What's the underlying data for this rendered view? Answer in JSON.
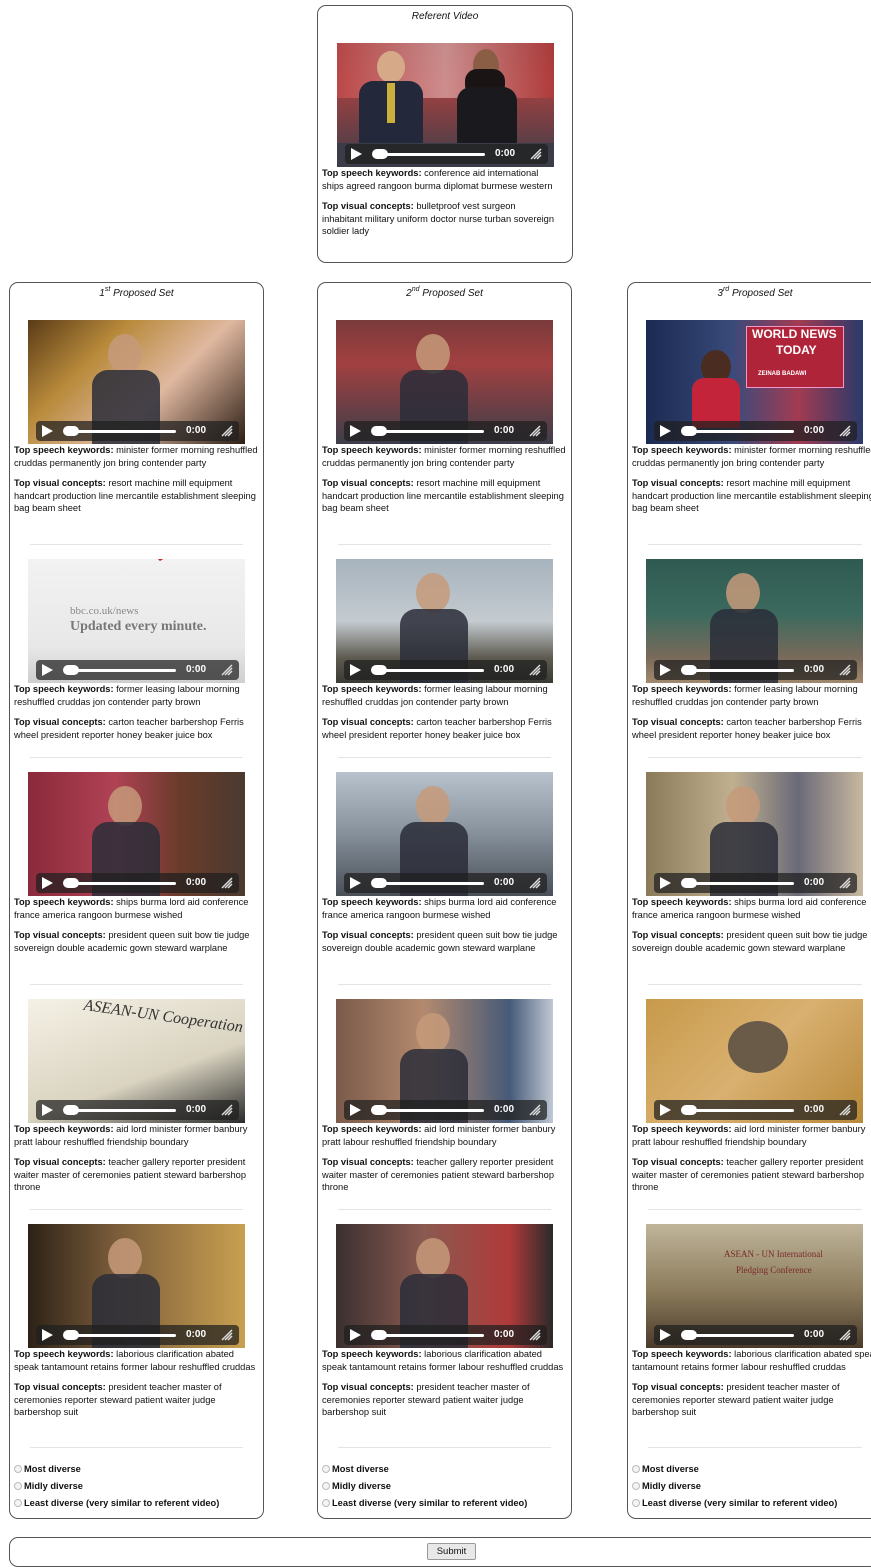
{
  "referent": {
    "title": "Referent Video",
    "time": "0:00",
    "speech_label": "Top speech keywords:",
    "speech": "conference aid international ships agreed rangoon burma diplomat burmese western",
    "visual_label": "Top visual concepts:",
    "visual": "bulletproof vest surgeon inhabitant military uniform doctor nurse turban sovereign soldier lady"
  },
  "sets": [
    {
      "num": "1",
      "sup": "st",
      "title_suffix": " Proposed Set",
      "videos": [
        {
          "time": "0:00",
          "speech_label": "Top speech keywords:",
          "speech": "minister former morning reshuffled cruddas permanently jon bring contender party",
          "visual_label": "Top visual concepts:",
          "visual": "resort machine mill equipment handcart production line mercantile establishment sleeping bag beam sheet"
        },
        {
          "time": "0:00",
          "speech_label": "Top speech keywords:",
          "speech": "former leasing labour morning reshuffled cruddas jon contender party brown",
          "visual_label": "Top visual concepts:",
          "visual": "carton teacher barbershop Ferris wheel president reporter honey beaker juice box",
          "overlay_text_1": "bbc.co.uk/news",
          "overlay_text_2": "Updated every minute."
        },
        {
          "time": "0:00",
          "speech_label": "Top speech keywords:",
          "speech": "ships burma lord aid conference france america rangoon burmese wished",
          "visual_label": "Top visual concepts:",
          "visual": "president queen suit bow tie judge sovereign double academic gown steward warplane"
        },
        {
          "time": "0:00",
          "speech_label": "Top speech keywords:",
          "speech": "aid lord minister former banbury pratt labour reshuffled friendship boundary",
          "visual_label": "Top visual concepts:",
          "visual": "teacher gallery reporter president waiter master of ceremonies patient steward barbershop throne",
          "overlay_text_1": "ASEAN-UN Cooperation"
        },
        {
          "time": "0:00",
          "speech_label": "Top speech keywords:",
          "speech": "laborious clarification abated speak tantamount retains former labour reshuffled cruddas",
          "visual_label": "Top visual concepts:",
          "visual": "president teacher master of ceremonies reporter steward patient waiter judge barbershop suit"
        }
      ],
      "ratings": [
        "Most diverse",
        "Midly diverse",
        "Least diverse (very similar to referent video)"
      ]
    },
    {
      "num": "2",
      "sup": "nd",
      "title_suffix": " Proposed Set",
      "videos": [
        {
          "time": "0:00",
          "speech_label": "Top speech keywords:",
          "speech": "minister former morning reshuffled cruddas permanently jon bring contender party",
          "visual_label": "Top visual concepts:",
          "visual": "resort machine mill equipment handcart production line mercantile establishment sleeping bag beam sheet"
        },
        {
          "time": "0:00",
          "speech_label": "Top speech keywords:",
          "speech": "former leasing labour morning reshuffled cruddas jon contender party brown",
          "visual_label": "Top visual concepts:",
          "visual": "carton teacher barbershop Ferris wheel president reporter honey beaker juice box"
        },
        {
          "time": "0:00",
          "speech_label": "Top speech keywords:",
          "speech": "ships burma lord aid conference france america rangoon burmese wished",
          "visual_label": "Top visual concepts:",
          "visual": "president queen suit bow tie judge sovereign double academic gown steward warplane"
        },
        {
          "time": "0:00",
          "speech_label": "Top speech keywords:",
          "speech": "aid lord minister former banbury pratt labour reshuffled friendship boundary",
          "visual_label": "Top visual concepts:",
          "visual": "teacher gallery reporter president waiter master of ceremonies patient steward barbershop throne"
        },
        {
          "time": "0:00",
          "speech_label": "Top speech keywords:",
          "speech": "laborious clarification abated speak tantamount retains former labour reshuffled cruddas",
          "visual_label": "Top visual concepts:",
          "visual": "president teacher master of ceremonies reporter steward patient waiter judge barbershop suit"
        }
      ],
      "ratings": [
        "Most diverse",
        "Midly diverse",
        "Least diverse (very similar to referent video)"
      ]
    },
    {
      "num": "3",
      "sup": "rd",
      "title_suffix": " Proposed Set",
      "videos": [
        {
          "time": "0:00",
          "speech_label": "Top speech keywords:",
          "speech": "minister former morning reshuffled cruddas permanently jon bring contender party",
          "visual_label": "Top visual concepts:",
          "visual": "resort machine mill equipment handcart production line mercantile establishment sleeping bag beam sheet",
          "overlay_text_1": "WORLD NEWS",
          "overlay_text_2": "TODAY",
          "overlay_text_3": "ZEINAB BADAWI"
        },
        {
          "time": "0:00",
          "speech_label": "Top speech keywords:",
          "speech": "former leasing labour morning reshuffled cruddas jon contender party brown",
          "visual_label": "Top visual concepts:",
          "visual": "carton teacher barbershop Ferris wheel president reporter honey beaker juice box"
        },
        {
          "time": "0:00",
          "speech_label": "Top speech keywords:",
          "speech": "ships burma lord aid conference france america rangoon burmese wished",
          "visual_label": "Top visual concepts:",
          "visual": "president queen suit bow tie judge sovereign double academic gown steward warplane"
        },
        {
          "time": "0:00",
          "speech_label": "Top speech keywords:",
          "speech": "aid lord minister former banbury pratt labour reshuffled friendship boundary",
          "visual_label": "Top visual concepts:",
          "visual": "teacher gallery reporter president waiter master of ceremonies patient steward barbershop throne"
        },
        {
          "time": "0:00",
          "speech_label": "Top speech keywords:",
          "speech": "laborious clarification abated speak tantamount retains former labour reshuffled cruddas",
          "visual_label": "Top visual concepts:",
          "visual": "president teacher master of ceremonies reporter steward patient waiter judge barbershop suit",
          "overlay_text_1": "ASEAN - UN International",
          "overlay_text_2": "Pledging Conference"
        }
      ],
      "ratings": [
        "Most diverse",
        "Midly diverse",
        "Least diverse (very similar to referent video)"
      ]
    }
  ],
  "submit_label": "Submit"
}
